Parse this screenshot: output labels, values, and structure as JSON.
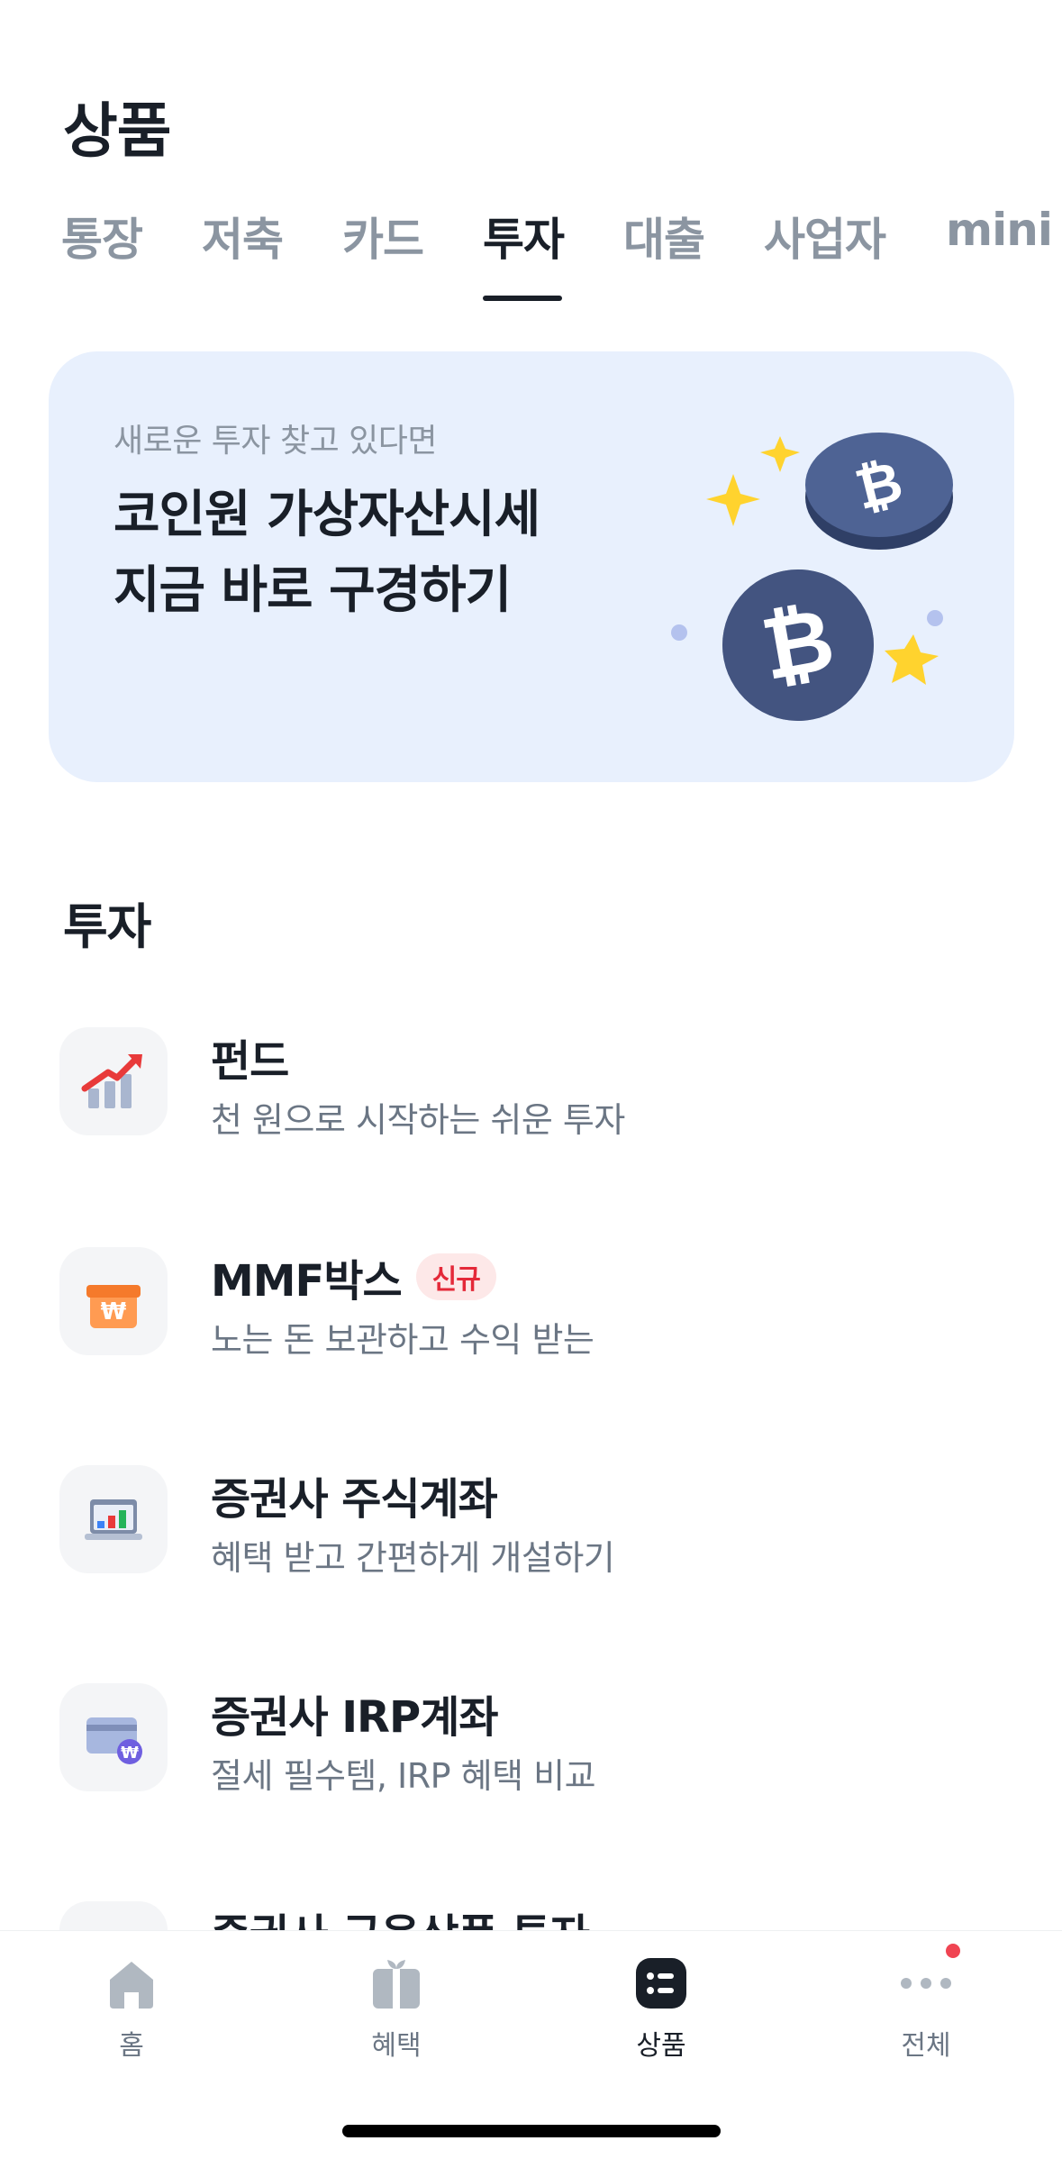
{
  "page": {
    "title": "상품"
  },
  "tabs": [
    {
      "label": "통장"
    },
    {
      "label": "저축"
    },
    {
      "label": "카드"
    },
    {
      "label": "투자"
    },
    {
      "label": "대출"
    },
    {
      "label": "사업자"
    },
    {
      "label": "mini"
    }
  ],
  "active_tab": "투자",
  "banner": {
    "eyebrow": "새로운 투자 찾고 있다면",
    "title_line1": "코인원 가상자산시세",
    "title_line2": "지금 바로 구경하기",
    "art_icon": "bitcoin-coins-illustration"
  },
  "section": {
    "title": "투자"
  },
  "items": [
    {
      "title": "펀드",
      "subtitle": "천 원으로 시작하는 쉬운 투자",
      "icon": "rising-chart-icon"
    },
    {
      "title": "MMF박스",
      "badge": "신규",
      "subtitle": "노는 돈 보관하고 수익 받는",
      "icon": "won-gift-box-icon"
    },
    {
      "title": "증권사 주식계좌",
      "subtitle": "혜택 받고 간편하게 개설하기",
      "icon": "laptop-chart-icon"
    },
    {
      "title": "증권사 IRP계좌",
      "subtitle": "절세 필수템, IRP 혜택 비교",
      "icon": "card-won-icon"
    },
    {
      "title": "증권사 금융상품 투자",
      "subtitle": "",
      "icon": "product-icon"
    }
  ],
  "tabbar": [
    {
      "label": "홈",
      "icon": "home-icon"
    },
    {
      "label": "혜택",
      "icon": "gift-icon"
    },
    {
      "label": "상품",
      "icon": "product-list-icon"
    },
    {
      "label": "전체",
      "icon": "more-dots-icon"
    }
  ],
  "colors": {
    "accent_text": "#191f28",
    "muted_text": "#8b95a1",
    "banner_bg": "#e8f0fd",
    "badge_red": "#e42939",
    "notification": "#f04452"
  }
}
